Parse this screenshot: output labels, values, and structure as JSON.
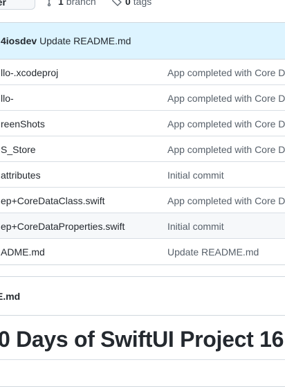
{
  "toolbar": {
    "branch_selector_label": "ter",
    "branches_count": "1",
    "branches_label": "branch",
    "tags_count": "0",
    "tags_label": "tags"
  },
  "latest_commit": {
    "author": "4iosdev",
    "message": "Update README.md"
  },
  "files": [
    {
      "name": "llo-.xcodeproj",
      "commit_message": "App completed with Core D"
    },
    {
      "name": "llo-",
      "commit_message": "App completed with Core D"
    },
    {
      "name": "reenShots",
      "commit_message": "App completed with Core D"
    },
    {
      "name": "S_Store",
      "commit_message": "App completed with Core D"
    },
    {
      "name": "attributes",
      "commit_message": "Initial commit"
    },
    {
      "name": "ep+CoreDataClass.swift",
      "commit_message": "App completed with Core D"
    },
    {
      "name": "ep+CoreDataProperties.swift",
      "commit_message": "Initial commit"
    },
    {
      "name": "ADME.md",
      "commit_message": "Update README.md"
    }
  ],
  "readme": {
    "filename": "E.md",
    "heading": "0 Days of SwiftUI Project 16"
  },
  "icons": {
    "branch": "git-branch-icon",
    "tag": "tag-icon",
    "chevron": "chevron-down-icon"
  },
  "colors": {
    "commit_header_bg": "#ddf4ff",
    "border": "#d0d7de",
    "muted_text": "#57606a"
  }
}
